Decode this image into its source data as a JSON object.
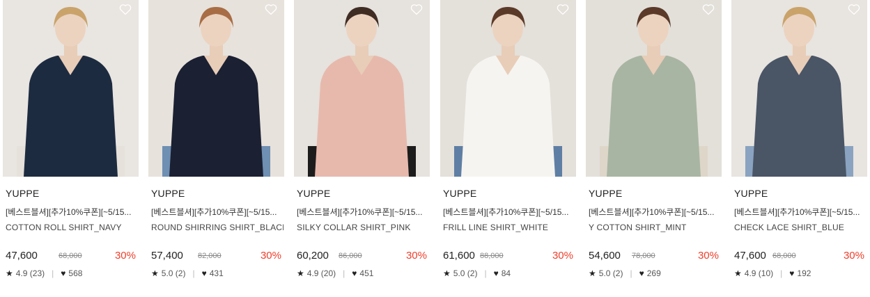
{
  "products": [
    {
      "brand": "YUPPE",
      "promo": "[베스트블셔][추가10%쿠폰][~5/15...",
      "name": "COTTON ROLL SHIRT_NAVY",
      "price": "47,600",
      "original_price": "68,000",
      "discount": "30%",
      "rating": "4.9",
      "reviews": "(23)",
      "likes": "568",
      "bg": "#e9e5e1",
      "shirt": "#1d2b40",
      "bottom": "#e6e1da",
      "hair": "#c9a36a"
    },
    {
      "brand": "YUPPE",
      "promo": "[베스트블셔][추가10%쿠폰][~5/15...",
      "name": "ROUND SHIRRING SHIRT_BLACK",
      "price": "57,400",
      "original_price": "82,000",
      "discount": "30%",
      "rating": "5.0",
      "reviews": "(2)",
      "likes": "431",
      "bg": "#e7e2dc",
      "shirt": "#1b2032",
      "bottom": "#6f8fb3",
      "hair": "#a86d45"
    },
    {
      "brand": "YUPPE",
      "promo": "[베스트블셔][추가10%쿠폰][~5/15...",
      "name": "SILKY COLLAR SHIRT_PINK",
      "price": "60,200",
      "original_price": "86,000",
      "discount": "30%",
      "rating": "4.9",
      "reviews": "(20)",
      "likes": "451",
      "bg": "#e6e2dd",
      "shirt": "#e7b9ad",
      "bottom": "#1c1c1c",
      "hair": "#3f2d24"
    },
    {
      "brand": "YUPPE",
      "promo": "[베스트블셔][추가10%쿠폰][~5/15...",
      "name": "FRILL LINE SHIRT_WHITE",
      "price": "61,600",
      "original_price": "88,000",
      "discount": "30%",
      "rating": "5.0",
      "reviews": "(2)",
      "likes": "84",
      "bg": "#e4e0da",
      "shirt": "#f6f4f0",
      "bottom": "#5f7ea3",
      "hair": "#5b3a29"
    },
    {
      "brand": "YUPPE",
      "promo": "[베스트블셔][추가10%쿠폰][~5/15...",
      "name": "Y COTTON SHIRT_MINT",
      "price": "54,600",
      "original_price": "78,000",
      "discount": "30%",
      "rating": "5.0",
      "reviews": "(2)",
      "likes": "269",
      "bg": "#e3e0da",
      "shirt": "#a9b5a3",
      "bottom": "#ddd6c9",
      "hair": "#5b3a29"
    },
    {
      "brand": "YUPPE",
      "promo": "[베스트블셔][추가10%쿠폰][~5/15...",
      "name": "CHECK LACE SHIRT_BLUE",
      "price": "47,600",
      "original_price": "68,000",
      "discount": "30%",
      "rating": "4.9",
      "reviews": "(10)",
      "likes": "192",
      "bg": "#e8e4df",
      "shirt": "#4a5566",
      "bottom": "#8aa3c0",
      "hair": "#c9a36a"
    }
  ],
  "icons": {
    "wishlist": "heart-outline-icon",
    "rating": "star-icon",
    "likes": "heart-filled-icon"
  },
  "colors": {
    "discount": "#ee3e2b",
    "strike": "#888888"
  }
}
